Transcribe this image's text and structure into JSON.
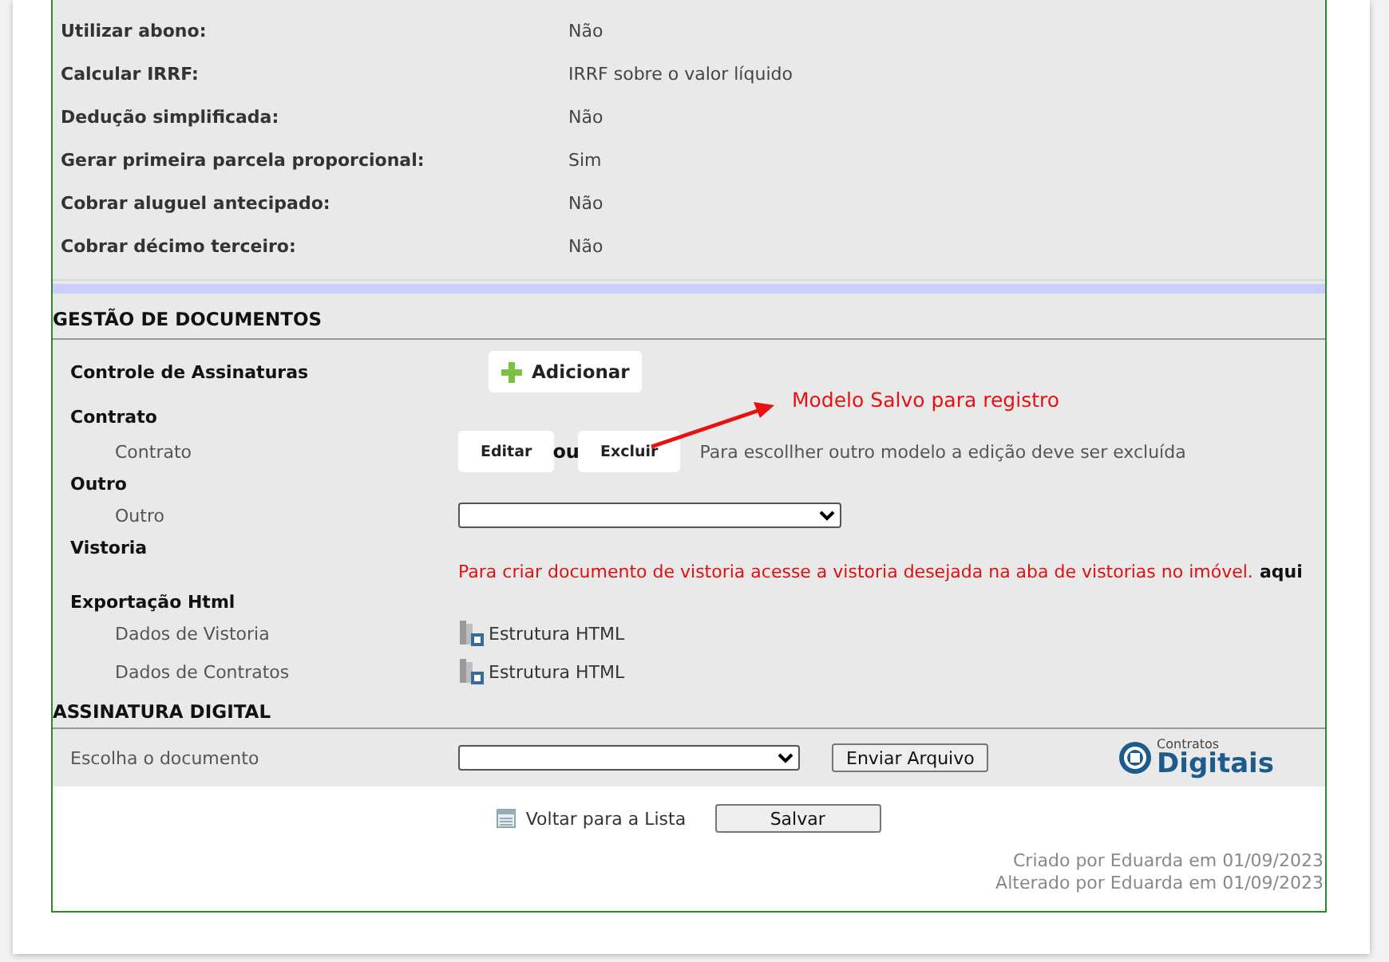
{
  "settings": [
    {
      "label": "Utilizar abono:",
      "value": "Não"
    },
    {
      "label": "Calcular IRRF:",
      "value": "IRRF sobre o valor líquido"
    },
    {
      "label": "Dedução simplificada:",
      "value": "Não"
    },
    {
      "label": "Gerar primeira parcela proporcional:",
      "value": "Sim"
    },
    {
      "label": "Cobrar aluguel antecipado:",
      "value": "Não"
    },
    {
      "label": "Cobrar décimo terceiro:",
      "value": "Não"
    }
  ],
  "documents": {
    "title": "GESTÃO DE DOCUMENTOS",
    "signature_control": {
      "label": "Controle de Assinaturas",
      "button": "Adicionar"
    },
    "contract": {
      "heading": "Contrato",
      "label": "Contrato",
      "edit": "Editar",
      "or": "ou",
      "delete": "Excluir",
      "hint": "Para escollher outro modelo a edição deve ser excluída"
    },
    "other": {
      "heading": "Outro",
      "label": "Outro"
    },
    "inspection": {
      "heading": "Vistoria",
      "message": "Para criar documento de vistoria acesse a vistoria desejada na aba de vistorias no imóvel.",
      "link": "aqui"
    },
    "html_export": {
      "heading": "Exportação Html",
      "rows": [
        {
          "label": "Dados de Vistoria",
          "link": "Estrutura HTML"
        },
        {
          "label": "Dados de Contratos",
          "link": "Estrutura HTML"
        }
      ]
    }
  },
  "digital_signature": {
    "title": "ASSINATURA DIGITAL",
    "label": "Escolha o documento",
    "button": "Enviar Arquivo",
    "logo_top": "Contratos",
    "logo_main": "Digitais"
  },
  "footer": {
    "back": "Voltar para a Lista",
    "save": "Salvar",
    "created": "Criado por Eduarda em 01/09/2023",
    "changed": "Alterado por Eduarda em 01/09/2023"
  },
  "annotation": {
    "text": "Modelo Salvo para registro"
  }
}
